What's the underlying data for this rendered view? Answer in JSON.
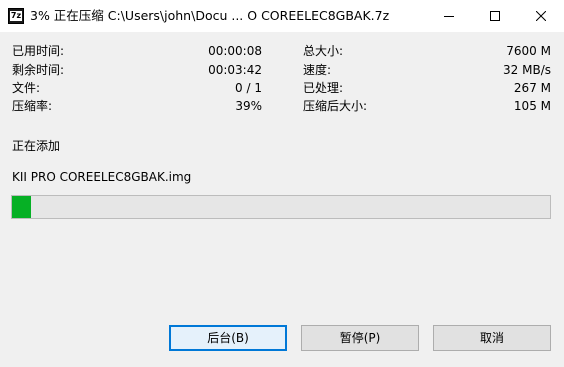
{
  "window": {
    "title": "3% 正在压缩 C:\\Users\\john\\Docu ... O COREELEC8GBAK.7z",
    "app_icon_text": "7z"
  },
  "stats_left": [
    {
      "label": "已用时间:",
      "value": "00:00:08"
    },
    {
      "label": "剩余时间:",
      "value": "00:03:42"
    },
    {
      "label": "文件:",
      "value": "0 / 1"
    },
    {
      "label": "压缩率:",
      "value": "39%"
    }
  ],
  "stats_right": [
    {
      "label": "总大小:",
      "value": "7600 M"
    },
    {
      "label": "速度:",
      "value": "32 MB/s"
    },
    {
      "label": "已处理:",
      "value": "267 M"
    },
    {
      "label": "压缩后大小:",
      "value": "105 M"
    }
  ],
  "status": {
    "action": "正在添加",
    "current_file": "KII PRO COREELEC8GBAK.img"
  },
  "progress": {
    "percent": 3.5,
    "color": "#06b025"
  },
  "buttons": {
    "background": "后台(B)",
    "pause": "暂停(P)",
    "cancel": "取消"
  }
}
